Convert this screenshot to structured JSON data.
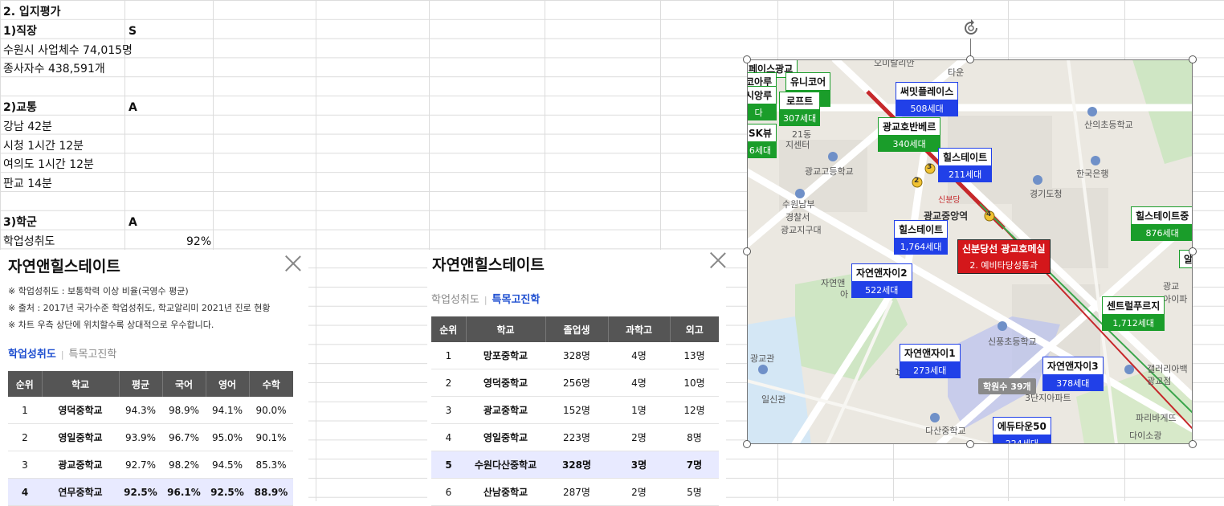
{
  "sheet": {
    "rows": [
      {
        "a": "2. 입지평가",
        "b": "",
        "bold": true
      },
      {
        "a": "1)직장",
        "b": "S",
        "bold": true
      },
      {
        "a": "수원시 사업체수 74,015명",
        "b": ""
      },
      {
        "a": "종사자수 438,591개",
        "b": ""
      },
      {
        "a": "",
        "b": ""
      },
      {
        "a": "2)교통",
        "b": "A",
        "bold": true
      },
      {
        "a": "강남 42분",
        "b": ""
      },
      {
        "a": "시청 1시간 12분",
        "b": ""
      },
      {
        "a": "여의도 1시간 12분",
        "b": ""
      },
      {
        "a": "판교 14분",
        "b": ""
      },
      {
        "a": "",
        "b": ""
      },
      {
        "a": "3)학군",
        "b": "A",
        "bold": true
      },
      {
        "a": "학업성취도",
        "b": "",
        "c": "92%"
      }
    ]
  },
  "popup_left": {
    "title": "자연앤힐스테이트",
    "notes": [
      "※ 학업성취도 : 보통학력 이상 비율(국영수 평균)",
      "※ 출처 : 2017년 국가수준 학업성취도, 학교알리미 2021년 진로 현황",
      "※ 차트 우측 상단에 위치할수록 상대적으로 우수합니다."
    ],
    "tabs": [
      {
        "label": "학업성취도",
        "active": true
      },
      {
        "label": "특목고진학",
        "active": false
      }
    ],
    "columns": [
      "순위",
      "학교",
      "평균",
      "국어",
      "영어",
      "수학"
    ],
    "rows": [
      [
        "1",
        "영덕중학교",
        "94.3%",
        "98.9%",
        "94.1%",
        "90.0%"
      ],
      [
        "2",
        "영일중학교",
        "93.9%",
        "96.7%",
        "95.0%",
        "90.1%"
      ],
      [
        "3",
        "광교중학교",
        "92.7%",
        "98.2%",
        "94.5%",
        "85.3%"
      ],
      [
        "4",
        "연무중학교",
        "92.5%",
        "96.1%",
        "92.5%",
        "88.9%"
      ]
    ],
    "highlight_row": 3
  },
  "popup_right": {
    "title": "자연앤힐스테이트",
    "tabs": [
      {
        "label": "학업성취도",
        "active": false
      },
      {
        "label": "특목고진학",
        "active": true
      }
    ],
    "columns": [
      "순위",
      "학교",
      "졸업생",
      "과학고",
      "외고"
    ],
    "rows": [
      [
        "1",
        "망포중학교",
        "328명",
        "4명",
        "13명"
      ],
      [
        "2",
        "영덕중학교",
        "256명",
        "4명",
        "10명"
      ],
      [
        "3",
        "광교중학교",
        "152명",
        "1명",
        "12명"
      ],
      [
        "4",
        "영일중학교",
        "223명",
        "2명",
        "8명"
      ],
      [
        "5",
        "수원다산중학교",
        "328명",
        "3명",
        "7명"
      ],
      [
        "6",
        "산남중학교",
        "287명",
        "2명",
        "5명"
      ]
    ],
    "highlight_row": 4
  },
  "map": {
    "markers": [
      {
        "name": "써밋플레이스",
        "units": "508세대",
        "color": "blue"
      },
      {
        "name": "광교호반베르",
        "units": "340세대",
        "color": "green"
      },
      {
        "name": "힐스테이트",
        "units": "211세대",
        "color": "blue"
      },
      {
        "name": "힐스테이트",
        "units": "1,764세대",
        "color": "blue"
      },
      {
        "name": "신분당선 광교호메실",
        "units": "2. 예비타당성통과",
        "color": "red"
      },
      {
        "name": "자연앤자이2",
        "units": "522세대",
        "color": "blue"
      },
      {
        "name": "센트럴푸르지",
        "units": "1,712세대",
        "color": "green"
      },
      {
        "name": "자연앤자이1",
        "units": "273세대",
        "color": "blue"
      },
      {
        "name": "자연앤자이3",
        "units": "378세대",
        "color": "blue"
      },
      {
        "name": "에듀타운50",
        "units": "224세대",
        "color": "blue"
      },
      {
        "name": "힐스테이트중",
        "units": "876세대",
        "color": "green"
      },
      {
        "name": "페이스광교",
        "units": "",
        "color": "green"
      },
      {
        "name": "코아루",
        "units": "",
        "color": "green"
      },
      {
        "name": "유니코어",
        "units": "다",
        "color": "green"
      },
      {
        "name": "시앙루",
        "units": "다",
        "color": "green"
      },
      {
        "name": "로프트",
        "units": "307세대",
        "color": "green"
      },
      {
        "name": "SK뷰",
        "units": "6세대",
        "color": "green"
      },
      {
        "name": "알",
        "units": "",
        "color": "green"
      }
    ],
    "labels": [
      "오미탈리안",
      "타운",
      "산의초등학교",
      "광교고등학교",
      "한국은행",
      "경기도청",
      "수원남부",
      "경찰서",
      "광교지구대",
      "광교중앙역",
      "신분당",
      "자연앤",
      "아",
      "광교관",
      "일신관",
      "신풍초등학교",
      "다산중학교",
      "갤러리아백",
      "광교점",
      "파리바게뜨",
      "다이소광",
      "광교",
      "아이파",
      "3단지아파트",
      "자이",
      "1",
      "지센터",
      "21동"
    ],
    "academy_badge": "학원수 39개",
    "station_numbers": [
      "3",
      "2",
      "4"
    ]
  }
}
